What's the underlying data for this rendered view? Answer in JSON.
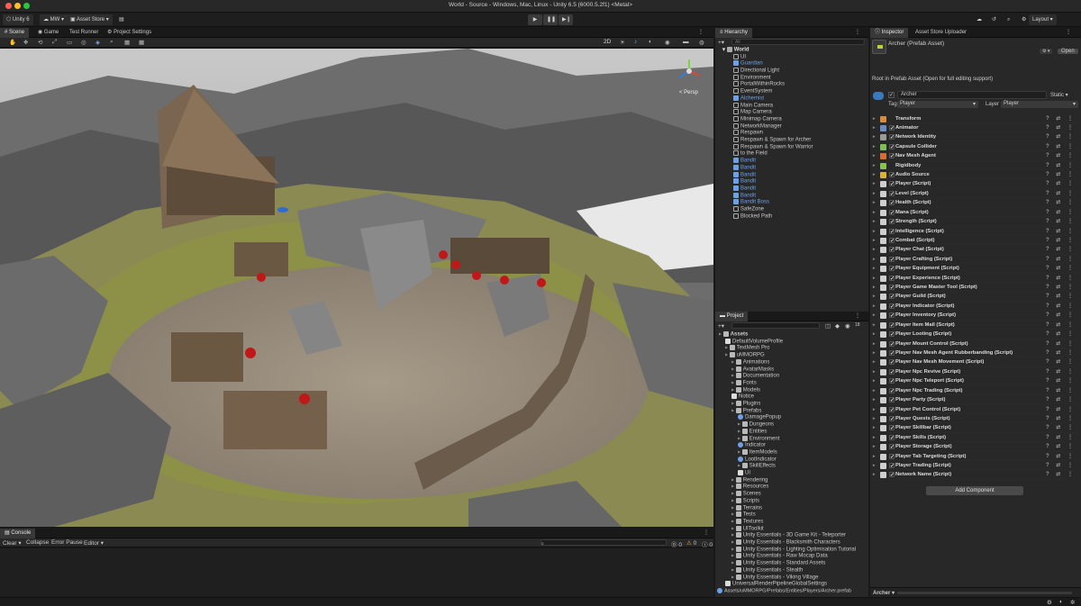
{
  "window": {
    "title": "World - Source - Windows, Mac, Linux - Unity 6.5 (6000.5.2f1) <Metal>"
  },
  "toolbar": {
    "unity": "Unity 6",
    "account": "MW",
    "asset_store": "Asset Store",
    "layout": "Layout"
  },
  "scene_tabs": [
    "Scene",
    "Game",
    "Test Runner",
    "Project Settings"
  ],
  "scene": {
    "persp_label": "< Persp",
    "zoom_badge": "2D"
  },
  "hierarchy": {
    "title": "Hierarchy",
    "search_placeholder": "All",
    "root": "World",
    "items": [
      {
        "label": "UI",
        "type": "go",
        "indent": 1
      },
      {
        "label": "Guardian",
        "type": "prefab",
        "indent": 1
      },
      {
        "label": "Directional Light",
        "type": "go",
        "indent": 1
      },
      {
        "label": "Environment",
        "type": "go",
        "indent": 1
      },
      {
        "label": "PortalWithinRocks",
        "type": "go",
        "indent": 1
      },
      {
        "label": "EventSystem",
        "type": "go",
        "indent": 1
      },
      {
        "label": "Alchemist",
        "type": "prefab",
        "indent": 1
      },
      {
        "label": "Main Camera",
        "type": "go",
        "indent": 1
      },
      {
        "label": "Map Camera",
        "type": "go",
        "indent": 1
      },
      {
        "label": "Minimap Camera",
        "type": "go",
        "indent": 1
      },
      {
        "label": "NetworkManager",
        "type": "go",
        "indent": 1
      },
      {
        "label": "Respawn",
        "type": "go",
        "indent": 1
      },
      {
        "label": "Respawn & Spawn for Archer",
        "type": "go",
        "indent": 1
      },
      {
        "label": "Respawn & Spawn for Warrior",
        "type": "go",
        "indent": 1
      },
      {
        "label": "to the Field",
        "type": "go",
        "indent": 1
      },
      {
        "label": "Bandit",
        "type": "prefab",
        "indent": 1
      },
      {
        "label": "Bandit",
        "type": "prefab",
        "indent": 1
      },
      {
        "label": "Bandit",
        "type": "prefab",
        "indent": 1
      },
      {
        "label": "Bandit",
        "type": "prefab",
        "indent": 1
      },
      {
        "label": "Bandit",
        "type": "prefab",
        "indent": 1
      },
      {
        "label": "Bandit",
        "type": "prefab",
        "indent": 1
      },
      {
        "label": "Bandit Boss",
        "type": "prefab",
        "indent": 1
      },
      {
        "label": "SafeZone",
        "type": "go",
        "indent": 1
      },
      {
        "label": "Blocked Path",
        "type": "go",
        "indent": 1
      }
    ]
  },
  "project": {
    "title": "Project",
    "path": "Assets/uMMORPG/Prefabs/Entities/Players/Archer.prefab",
    "count": "18",
    "items": [
      {
        "label": "Assets",
        "indent": 0,
        "type": "folder"
      },
      {
        "label": "DefaultVolumeProfile",
        "indent": 1,
        "type": "asset"
      },
      {
        "label": "TextMesh Pro",
        "indent": 1,
        "type": "folder"
      },
      {
        "label": "uMMORPG",
        "indent": 1,
        "type": "folder"
      },
      {
        "label": "Animations",
        "indent": 2,
        "type": "folder"
      },
      {
        "label": "AvatarMasks",
        "indent": 2,
        "type": "folder"
      },
      {
        "label": "Documentation",
        "indent": 2,
        "type": "folder"
      },
      {
        "label": "Fonts",
        "indent": 2,
        "type": "folder"
      },
      {
        "label": "Models",
        "indent": 2,
        "type": "folder"
      },
      {
        "label": "Notice",
        "indent": 2,
        "type": "asset"
      },
      {
        "label": "Plugins",
        "indent": 2,
        "type": "folder"
      },
      {
        "label": "Prefabs",
        "indent": 2,
        "type": "folder"
      },
      {
        "label": "DamagePopup",
        "indent": 3,
        "type": "prefab"
      },
      {
        "label": "Dungeons",
        "indent": 3,
        "type": "folder"
      },
      {
        "label": "Entities",
        "indent": 3,
        "type": "folder"
      },
      {
        "label": "Environment",
        "indent": 3,
        "type": "folder"
      },
      {
        "label": "Indicator",
        "indent": 3,
        "type": "prefab"
      },
      {
        "label": "ItemModels",
        "indent": 3,
        "type": "folder"
      },
      {
        "label": "LootIndicator",
        "indent": 3,
        "type": "prefab"
      },
      {
        "label": "SkillEffects",
        "indent": 3,
        "type": "folder"
      },
      {
        "label": "UI",
        "indent": 3,
        "type": "asset"
      },
      {
        "label": "Rendering",
        "indent": 2,
        "type": "folder"
      },
      {
        "label": "Resources",
        "indent": 2,
        "type": "folder"
      },
      {
        "label": "Scenes",
        "indent": 2,
        "type": "folder"
      },
      {
        "label": "Scripts",
        "indent": 2,
        "type": "folder"
      },
      {
        "label": "Terrains",
        "indent": 2,
        "type": "folder"
      },
      {
        "label": "Tests",
        "indent": 2,
        "type": "folder"
      },
      {
        "label": "Textures",
        "indent": 2,
        "type": "folder"
      },
      {
        "label": "UIToolkit",
        "indent": 2,
        "type": "folder"
      },
      {
        "label": "Unity Essentials - 3D Game Kit - Teleporter",
        "indent": 2,
        "type": "folder"
      },
      {
        "label": "Unity Essentials - Blacksmith Characters",
        "indent": 2,
        "type": "folder"
      },
      {
        "label": "Unity Essentials - Lighting Optimisation Tutorial",
        "indent": 2,
        "type": "folder"
      },
      {
        "label": "Unity Essentials - Raw Mocap Data",
        "indent": 2,
        "type": "folder"
      },
      {
        "label": "Unity Essentials - Standard Assets",
        "indent": 2,
        "type": "folder"
      },
      {
        "label": "Unity Essentials - Stealth",
        "indent": 2,
        "type": "folder"
      },
      {
        "label": "Unity Essentials - Viking Village",
        "indent": 2,
        "type": "folder"
      },
      {
        "label": "UniversalRenderPipelineGlobalSettings",
        "indent": 1,
        "type": "asset"
      }
    ]
  },
  "inspector": {
    "tabs": [
      "Inspector",
      "Asset Store Uploader"
    ],
    "asset_title": "Archer (Prefab Asset)",
    "open_button": "Open",
    "root_note": "Root in Prefab Asset (Open for full editing support)",
    "name": "Archer",
    "static_label": "Static",
    "tag_label": "Tag",
    "tag_value": "Player",
    "layer_label": "Layer",
    "layer_value": "Player",
    "add_component": "Add Component",
    "footer_label": "Archer",
    "components": [
      {
        "label": "Transform",
        "icon": "#d98a3a",
        "checkbox": false
      },
      {
        "label": "Animator",
        "icon": "#6a8cbf",
        "checkbox": true
      },
      {
        "label": "Network Identity",
        "icon": "#9a9a9a",
        "checkbox": true
      },
      {
        "label": "Capsule Collider",
        "icon": "#7fbf5a",
        "checkbox": true
      },
      {
        "label": "Nav Mesh Agent",
        "icon": "#d96a3a",
        "checkbox": true
      },
      {
        "label": "Rigidbody",
        "icon": "#8bc34a",
        "checkbox": false
      },
      {
        "label": "Audio Source",
        "icon": "#d9b03a",
        "checkbox": true
      },
      {
        "label": "Player (Script)",
        "icon": "#cfcfcf",
        "checkbox": true
      },
      {
        "label": "Level (Script)",
        "icon": "#cfcfcf",
        "checkbox": true
      },
      {
        "label": "Health (Script)",
        "icon": "#cfcfcf",
        "checkbox": true
      },
      {
        "label": "Mana (Script)",
        "icon": "#cfcfcf",
        "checkbox": true
      },
      {
        "label": "Strength (Script)",
        "icon": "#cfcfcf",
        "checkbox": true
      },
      {
        "label": "Intelligence (Script)",
        "icon": "#cfcfcf",
        "checkbox": true
      },
      {
        "label": "Combat (Script)",
        "icon": "#cfcfcf",
        "checkbox": true
      },
      {
        "label": "Player Chat (Script)",
        "icon": "#cfcfcf",
        "checkbox": true
      },
      {
        "label": "Player Crafting (Script)",
        "icon": "#cfcfcf",
        "checkbox": true
      },
      {
        "label": "Player Equipment (Script)",
        "icon": "#cfcfcf",
        "checkbox": true
      },
      {
        "label": "Player Experience (Script)",
        "icon": "#cfcfcf",
        "checkbox": true
      },
      {
        "label": "Player Game Master Tool (Script)",
        "icon": "#cfcfcf",
        "checkbox": true
      },
      {
        "label": "Player Guild (Script)",
        "icon": "#cfcfcf",
        "checkbox": true
      },
      {
        "label": "Player Indicator (Script)",
        "icon": "#cfcfcf",
        "checkbox": true
      },
      {
        "label": "Player Inventory (Script)",
        "icon": "#cfcfcf",
        "checkbox": true
      },
      {
        "label": "Player Item Mall (Script)",
        "icon": "#cfcfcf",
        "checkbox": true
      },
      {
        "label": "Player Looting (Script)",
        "icon": "#cfcfcf",
        "checkbox": true
      },
      {
        "label": "Player Mount Control (Script)",
        "icon": "#cfcfcf",
        "checkbox": true
      },
      {
        "label": "Player Nav Mesh Agent Rubberbanding (Script)",
        "icon": "#cfcfcf",
        "checkbox": true
      },
      {
        "label": "Player Nav Mesh Movement (Script)",
        "icon": "#cfcfcf",
        "checkbox": true
      },
      {
        "label": "Player Npc Revive (Script)",
        "icon": "#cfcfcf",
        "checkbox": true
      },
      {
        "label": "Player Npc Teleport (Script)",
        "icon": "#cfcfcf",
        "checkbox": true
      },
      {
        "label": "Player Npc Trading (Script)",
        "icon": "#cfcfcf",
        "checkbox": true
      },
      {
        "label": "Player Party (Script)",
        "icon": "#cfcfcf",
        "checkbox": true
      },
      {
        "label": "Player Pet Control (Script)",
        "icon": "#cfcfcf",
        "checkbox": true
      },
      {
        "label": "Player Quests (Script)",
        "icon": "#cfcfcf",
        "checkbox": true
      },
      {
        "label": "Player Skillbar (Script)",
        "icon": "#cfcfcf",
        "checkbox": true
      },
      {
        "label": "Player Skills (Script)",
        "icon": "#cfcfcf",
        "checkbox": true
      },
      {
        "label": "Player Storage (Script)",
        "icon": "#cfcfcf",
        "checkbox": true
      },
      {
        "label": "Player Tab Targeting (Script)",
        "icon": "#cfcfcf",
        "checkbox": true
      },
      {
        "label": "Player Trading (Script)",
        "icon": "#cfcfcf",
        "checkbox": true
      },
      {
        "label": "Network Name (Script)",
        "icon": "#cfcfcf",
        "checkbox": true
      }
    ]
  },
  "console": {
    "title": "Console",
    "clear": "Clear",
    "collapse": "Collapse",
    "error_pause": "Error Pause",
    "editor": "Editor",
    "count_errors": "0",
    "count_warnings": "0",
    "count_logs": "0"
  },
  "colors": {
    "accent": "#3a79bb",
    "prefab_blue": "#6ea0e8",
    "selection": "#2c5d87"
  }
}
